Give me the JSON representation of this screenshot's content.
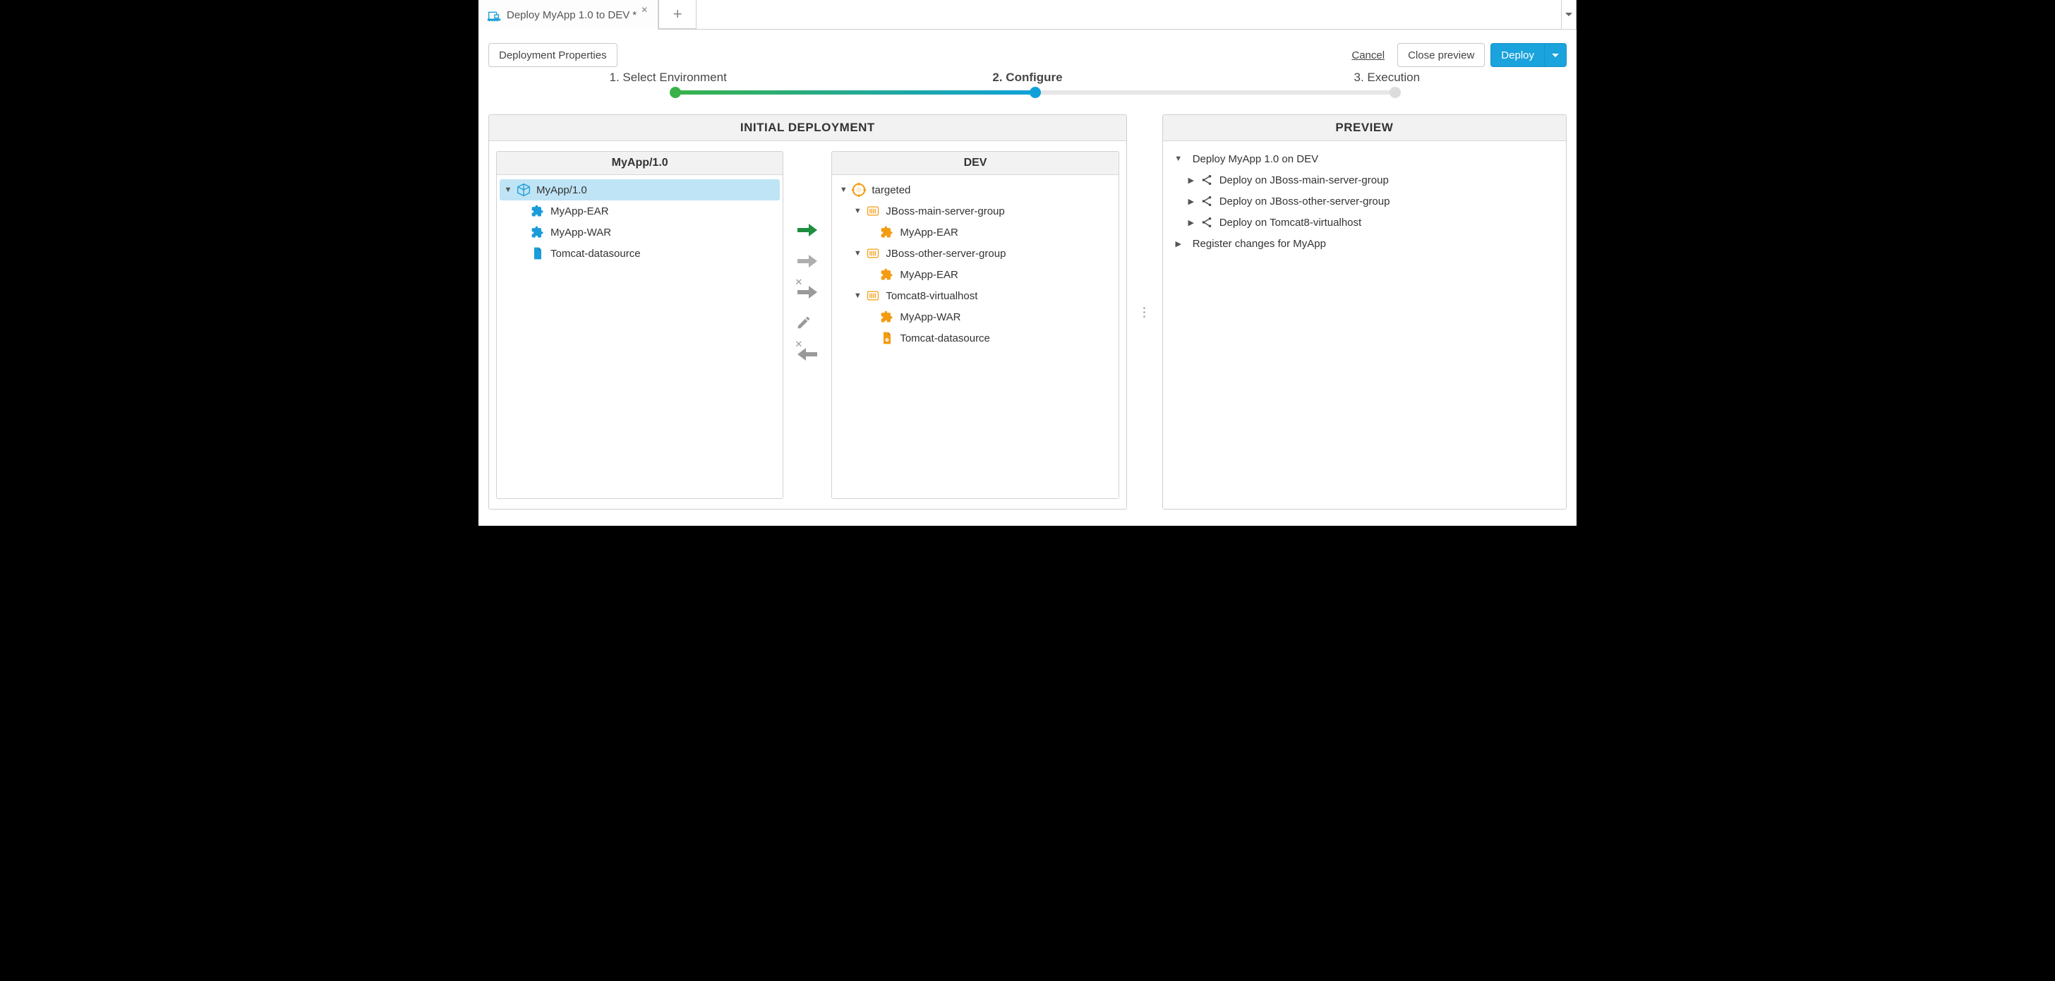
{
  "tab": {
    "title": "Deploy MyApp 1.0 to DEV",
    "dirty": "*"
  },
  "toolbar": {
    "properties": "Deployment Properties",
    "cancel": "Cancel",
    "close_preview": "Close preview",
    "deploy": "Deploy"
  },
  "steps": {
    "s1": "1. Select Environment",
    "s2": "2. Configure",
    "s3": "3. Execution"
  },
  "panels": {
    "deploy_header": "INITIAL DEPLOYMENT",
    "preview_header": "PREVIEW",
    "source_header": "MyApp/1.0",
    "target_header": "DEV"
  },
  "source_tree": {
    "root": "MyApp/1.0",
    "children": [
      "MyApp-EAR",
      "MyApp-WAR",
      "Tomcat-datasource"
    ]
  },
  "target_tree": {
    "root": "targeted",
    "groups": [
      {
        "name": "JBoss-main-server-group",
        "children": [
          {
            "name": "MyApp-EAR",
            "icon": "puzzle"
          }
        ]
      },
      {
        "name": "JBoss-other-server-group",
        "children": [
          {
            "name": "MyApp-EAR",
            "icon": "puzzle"
          }
        ]
      },
      {
        "name": "Tomcat8-virtualhost",
        "children": [
          {
            "name": "MyApp-WAR",
            "icon": "puzzle"
          },
          {
            "name": "Tomcat-datasource",
            "icon": "file"
          }
        ]
      }
    ]
  },
  "preview": {
    "root": "Deploy MyApp 1.0 on DEV",
    "items": [
      "Deploy on JBoss-main-server-group",
      "Deploy on JBoss-other-server-group",
      "Deploy on Tomcat8-virtualhost"
    ],
    "register": "Register changes for MyApp"
  },
  "icons": {
    "deploy_tab": "deploy-icon",
    "plus": "plus-icon",
    "chevron_down": "chevron-down-icon"
  }
}
